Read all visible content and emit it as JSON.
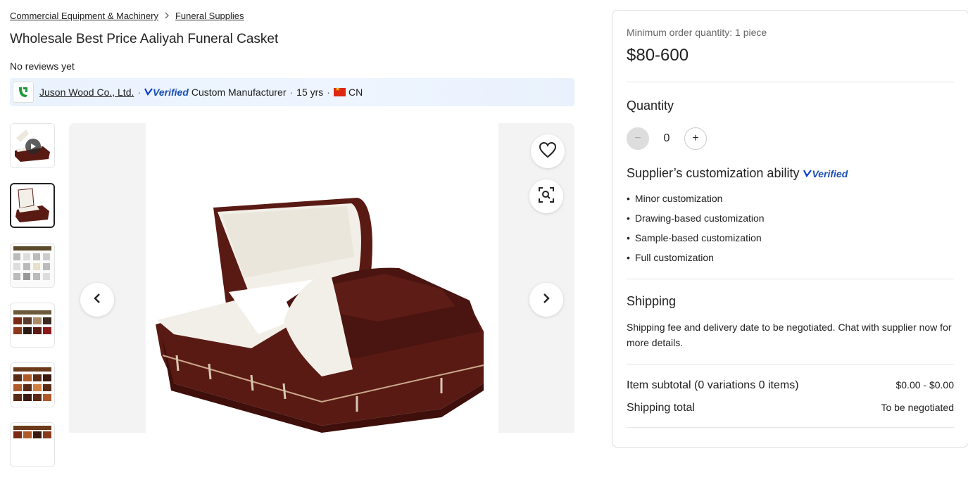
{
  "breadcrumb": [
    "Commercial Equipment & Machinery",
    "Funeral Supplies"
  ],
  "product": {
    "title": "Wholesale Best Price Aaliyah Funeral Casket",
    "reviews": "No reviews yet"
  },
  "supplier": {
    "name": "Juson Wood Co., Ltd.",
    "verified_label": "Verified",
    "type": "Custom Manufacturer",
    "years": "15 yrs",
    "country": "CN"
  },
  "purchase": {
    "moq": "Minimum order quantity: 1 piece",
    "price": "$80-600",
    "quantity_label": "Quantity",
    "quantity_value": "0",
    "minus": "−",
    "plus": "+"
  },
  "customization": {
    "title": "Supplier’s customization ability",
    "verified_label": "Verified",
    "items": [
      "Minor customization",
      "Drawing-based customization",
      "Sample-based customization",
      "Full customization"
    ]
  },
  "shipping": {
    "title": "Shipping",
    "text": "Shipping fee and delivery date to be negotiated. Chat with supplier now for more details."
  },
  "totals": {
    "subtotal_label": "Item subtotal (0 variations 0 items)",
    "subtotal_value": "$0.00 - $0.00",
    "shipping_label": "Shipping total",
    "shipping_value": "To be negotiated"
  },
  "colors": {
    "casket_wood": "#5a1a14",
    "lining": "#f2efe8",
    "verified_blue": "#1a4fb3"
  }
}
